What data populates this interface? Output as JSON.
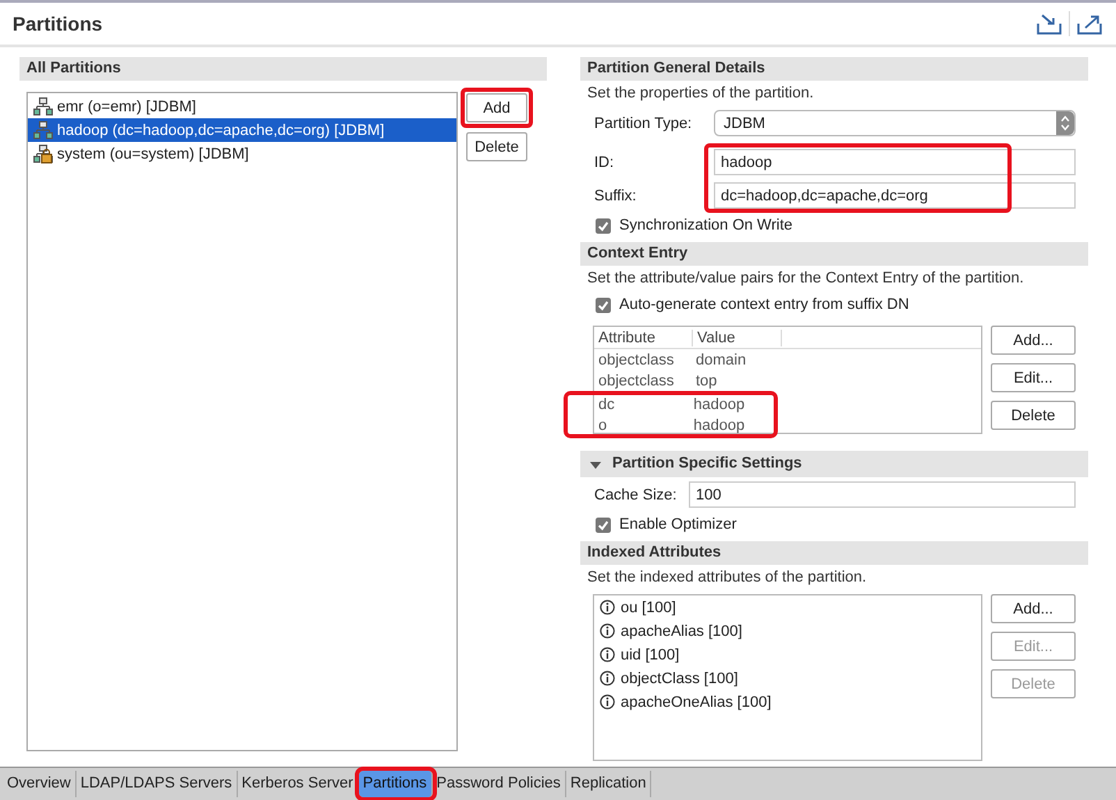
{
  "title": "Partitions",
  "all_partitions": {
    "heading": "All Partitions",
    "items": [
      {
        "label": "emr (o=emr) [JDBM]",
        "kind": "plain",
        "selected": false
      },
      {
        "label": "hadoop (dc=hadoop,dc=apache,dc=org) [JDBM]",
        "kind": "plain",
        "selected": true
      },
      {
        "label": "system (ou=system) [JDBM]",
        "kind": "locked",
        "selected": false
      }
    ],
    "buttons": [
      {
        "label": "Add",
        "highlighted": true
      },
      {
        "label": "Delete",
        "highlighted": false
      }
    ]
  },
  "general": {
    "heading": "Partition General Details",
    "description": "Set the properties of the partition.",
    "type_label": "Partition Type:",
    "type_value": "JDBM",
    "id_label": "ID:",
    "id_value": "hadoop",
    "suffix_label": "Suffix:",
    "suffix_value": "dc=hadoop,dc=apache,dc=org",
    "fields_highlighted": true,
    "sync": {
      "label": "Synchronization On Write",
      "checked": true
    }
  },
  "context_entry": {
    "heading": "Context Entry",
    "description": "Set the attribute/value pairs for the Context Entry of the partition.",
    "autogen": {
      "label": "Auto-generate context entry from suffix DN",
      "checked": true
    },
    "columns": [
      "Attribute",
      "Value"
    ],
    "rows": [
      {
        "attribute": "objectclass",
        "value": "domain",
        "highlighted": false
      },
      {
        "attribute": "objectclass",
        "value": "top",
        "highlighted": false
      },
      {
        "attribute": "dc",
        "value": "hadoop",
        "highlighted": true
      },
      {
        "attribute": "o",
        "value": "hadoop",
        "highlighted": true
      }
    ],
    "buttons": [
      {
        "label": "Add...",
        "disabled": false
      },
      {
        "label": "Edit...",
        "disabled": false
      },
      {
        "label": "Delete",
        "disabled": false
      }
    ]
  },
  "specific": {
    "heading": "Partition Specific Settings",
    "expanded": true,
    "cache_label": "Cache Size:",
    "cache_value": "100",
    "optimizer": {
      "label": "Enable Optimizer",
      "checked": true
    }
  },
  "indexed": {
    "heading": "Indexed Attributes",
    "description": "Set the indexed attributes of the partition.",
    "items": [
      "ou [100]",
      "apacheAlias [100]",
      "uid [100]",
      "objectClass [100]",
      "apacheOneAlias [100]"
    ],
    "buttons": [
      {
        "label": "Add...",
        "disabled": false
      },
      {
        "label": "Edit...",
        "disabled": true
      },
      {
        "label": "Delete",
        "disabled": true
      }
    ]
  },
  "tabs": [
    {
      "label": "Overview",
      "selected": false,
      "highlighted": false
    },
    {
      "label": "LDAP/LDAPS Servers",
      "selected": false,
      "highlighted": false
    },
    {
      "label": "Kerberos Server",
      "selected": false,
      "highlighted": false
    },
    {
      "label": "Partitions",
      "selected": true,
      "highlighted": true
    },
    {
      "label": "Password Policies",
      "selected": false,
      "highlighted": false
    },
    {
      "label": "Replication",
      "selected": false,
      "highlighted": false
    }
  ]
}
